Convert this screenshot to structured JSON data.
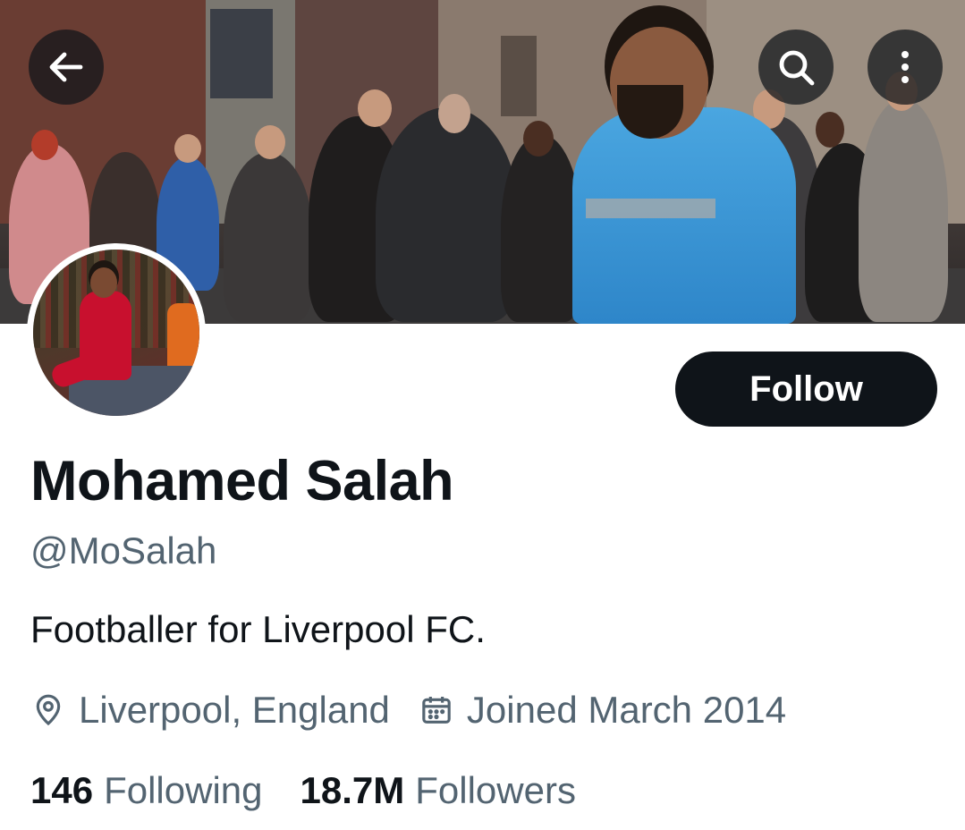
{
  "profile": {
    "display_name": "Mohamed Salah",
    "handle": "@MoSalah",
    "bio": "Footballer for Liverpool FC.",
    "location": "Liverpool, England",
    "joined": "Joined March 2014"
  },
  "actions": {
    "follow_label": "Follow"
  },
  "stats": {
    "following_count": "146",
    "following_label": "Following",
    "followers_count": "18.7M",
    "followers_label": "Followers"
  },
  "icons": {
    "back": "arrow-left-icon",
    "search": "search-icon",
    "more": "more-vertical-icon",
    "location": "location-pin-icon",
    "calendar": "calendar-icon"
  },
  "colors": {
    "text_primary": "#0f1419",
    "text_secondary": "#536471",
    "button_bg": "#0f1419",
    "button_text": "#ffffff"
  }
}
